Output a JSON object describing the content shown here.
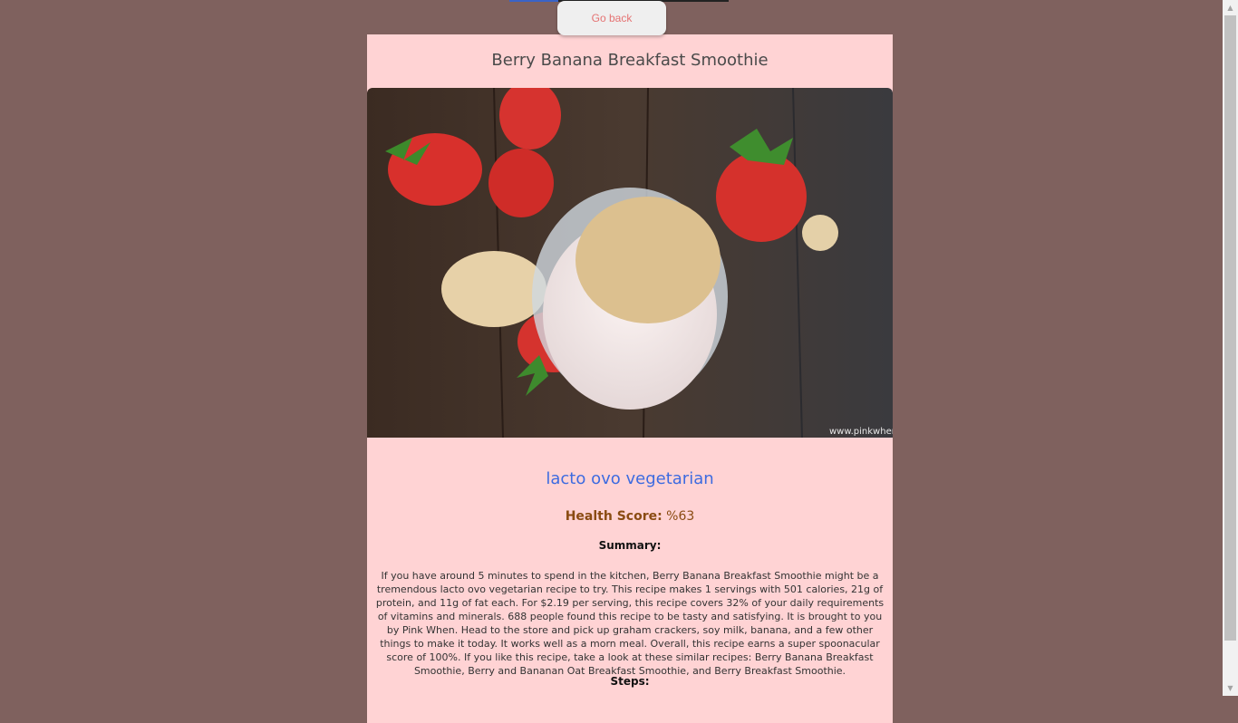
{
  "nav": {
    "go_back_label": "Go back"
  },
  "recipe": {
    "title": "Berry Banana Breakfast Smoothie",
    "photo_watermark": "www.pinkwhen.com",
    "diet": "lacto ovo vegetarian",
    "health_label": "Health Score:",
    "health_value": "%63",
    "summary_label": "Summary:",
    "summary_text": "If you have around 5 minutes to spend in the kitchen, Berry Banana Breakfast Smoothie might be a tremendous lacto ovo vegetarian recipe to try. This recipe makes 1 servings with 501 calories, 21g of protein, and 11g of fat each. For $2.19 per serving, this recipe covers 32% of your daily requirements of vitamins and minerals. 688 people found this recipe to be tasty and satisfying. It is brought to you by Pink When. Head to the store and pick up graham crackers, soy milk, banana, and a few other things to make it today. It works well as a morn meal. Overall, this recipe earns a super spoonacular score of 100%. If you like this recipe, take a look at these similar recipes: Berry Banana Breakfast Smoothie, Berry and Bananan Oat Breakfast Smoothie, and Berry Breakfast Smoothie.",
    "steps_label": "Steps:"
  },
  "colors": {
    "page_bg": "#7f615e",
    "card_bg": "#ffd3d4",
    "diet_text": "#3d6be0",
    "health_text": "#8a4b12",
    "go_back_text": "#e57373"
  },
  "icons": {
    "scroll_up": "scroll-up-arrow-icon",
    "scroll_down": "scroll-down-arrow-icon"
  }
}
